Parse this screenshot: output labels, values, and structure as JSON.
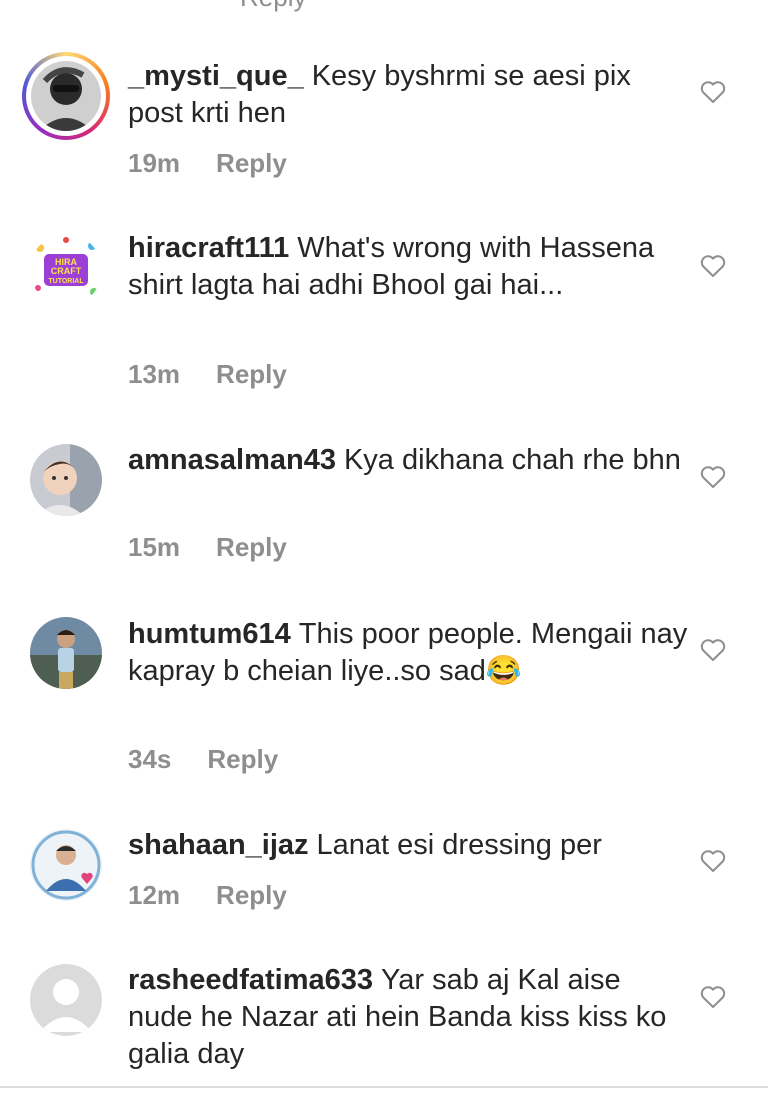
{
  "top_partial": {
    "reply_label": "Reply"
  },
  "comments": [
    {
      "username": "_mysti_que_",
      "text": "Kesy byshrmi se aesi pix post krti hen",
      "time": "19m",
      "reply_label": "Reply"
    },
    {
      "username": "hiracraft111",
      "text": "What's wrong with Hassena shirt lagta hai adhi Bhool gai hai...",
      "time": "13m",
      "reply_label": "Reply",
      "avatar_text": "HIRA CRAFT TUTORIAL"
    },
    {
      "username": "amnasalman43",
      "text": "Kya dikhana chah rhe bhn",
      "time": "15m",
      "reply_label": "Reply"
    },
    {
      "username": "humtum614",
      "text": "This poor people. Mengaii nay kapray b cheian liye..so sad😂",
      "time": "34s",
      "reply_label": "Reply"
    },
    {
      "username": "shahaan_ijaz",
      "text": "Lanat esi dressing per",
      "time": "12m",
      "reply_label": "Reply"
    },
    {
      "username": "rasheedfatima633",
      "text": "Yar sab aj Kal aise nude he Nazar ati hein Banda kiss kiss ko galia day",
      "time": "",
      "reply_label": ""
    }
  ],
  "icons": {
    "like": "heart-outline-icon",
    "avatar_placeholder": "default-user-icon"
  },
  "colors": {
    "text": "#262626",
    "meta": "#8e8e8e",
    "heart_stroke": "#8e8e8e",
    "story_ring": [
      "#feda75",
      "#fa7e1e",
      "#d62976",
      "#962fbf",
      "#4f5bd5"
    ]
  }
}
